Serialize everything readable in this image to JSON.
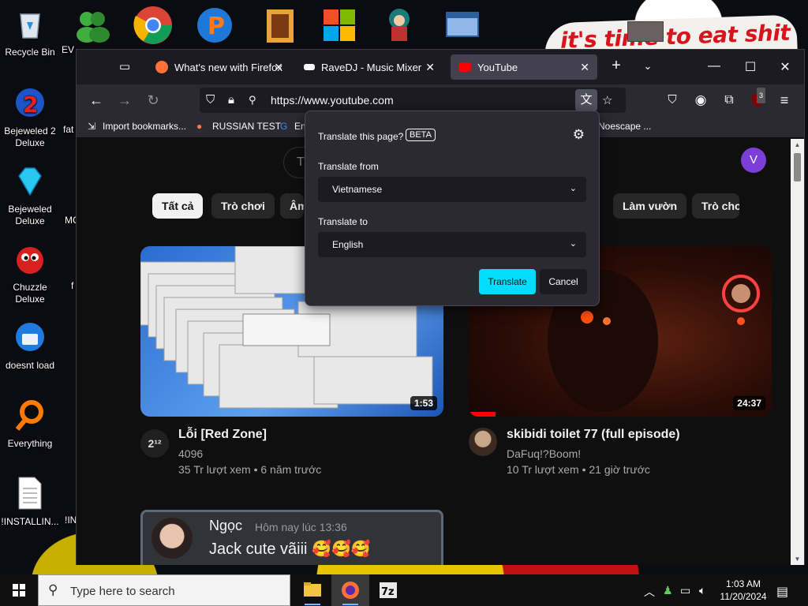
{
  "desktop": {
    "note_text": "it's time to eat shit",
    "icons": [
      {
        "label": "Recycle Bin"
      },
      {
        "label": "Bejeweled 2 Deluxe"
      },
      {
        "label": "Bejeweled Deluxe"
      },
      {
        "label": "Chuzzle Deluxe"
      },
      {
        "label": "doesnt load"
      },
      {
        "label": "Everything"
      },
      {
        "label": "!INSTALLIN..."
      }
    ],
    "partial_labels": [
      "EV",
      "M",
      "fat",
      "MG",
      "f",
      "!IN"
    ]
  },
  "browser": {
    "tabs": [
      {
        "title": "What's new with Firefox",
        "favicon_color": "#ff7139"
      },
      {
        "title": "RaveDJ - Music Mixer",
        "favicon_color": "#ffffff"
      },
      {
        "title": "YouTube",
        "favicon_color": "#ff0000"
      }
    ],
    "url": "https://www.youtube.com",
    "extension_badge": "3",
    "bookmarks": [
      {
        "label": "Import bookmarks..."
      },
      {
        "label": "RUSSIAN TEST"
      },
      {
        "label": "En"
      },
      {
        "label": "Noescape ..."
      }
    ]
  },
  "youtube": {
    "search_partial": "Tì",
    "avatar_letter": "V",
    "chips": [
      "Tất cả",
      "Trò chơi",
      "Âm",
      "Làm vườn",
      "Trò chơ"
    ],
    "videos": [
      {
        "title": "Lỗi [Red Zone]",
        "channel": "4096",
        "meta": "35 Tr lượt xem • 6 năm trước",
        "duration": "1:53",
        "channel_badge": "2¹²"
      },
      {
        "title": "skibidi toilet 77 (full episode)",
        "channel": "DaFuq!?Boom!",
        "meta": "10 Tr lượt xem • 21 giờ trước",
        "duration": "24:37"
      }
    ],
    "discord": {
      "name": "Ngọc",
      "time": "Hôm nay lúc 13:36",
      "message": "Jack cute vãiii 🥰🥰🥰"
    }
  },
  "translate": {
    "header": "Translate this page?",
    "beta": "BETA",
    "from_label": "Translate from",
    "from_value": "Vietnamese",
    "to_label": "Translate to",
    "to_value": "English",
    "primary": "Translate",
    "cancel": "Cancel"
  },
  "taskbar": {
    "search_placeholder": "Type here to search",
    "time": "1:03 AM",
    "date": "11/20/2024"
  }
}
